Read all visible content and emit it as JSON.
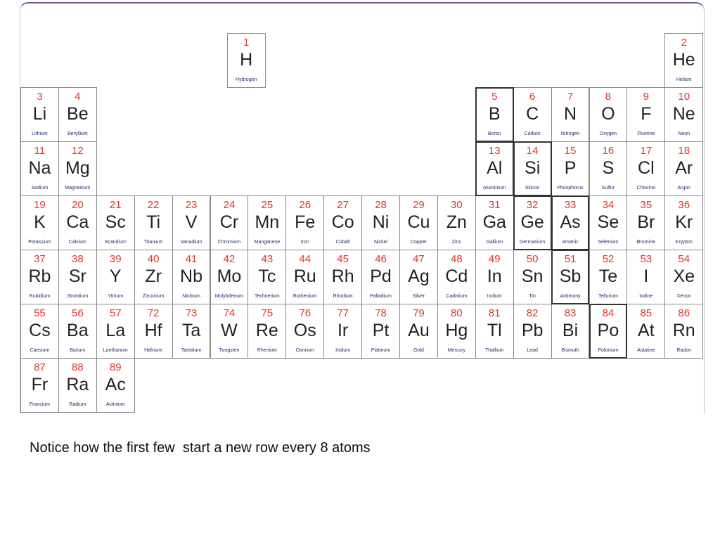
{
  "slide": {
    "caption": "Notice how the first few  start a new row every 8 atoms"
  },
  "colors": {
    "number": "#e3352a",
    "symbol": "#222222",
    "name": "#1d2d6b",
    "grid": "#8a8a8a",
    "heavy": "#333333",
    "frame_top": "#7b5a98",
    "frame_side": "#c4c4c4",
    "caption": "#111111"
  },
  "periodic_table": {
    "rows": [
      [
        {
          "number": 1,
          "symbol": "H",
          "name": "Hydrogen"
        },
        {
          "number": 2,
          "symbol": "He",
          "name": "Helium"
        }
      ],
      [
        {
          "number": 3,
          "symbol": "Li",
          "name": "Lithium"
        },
        {
          "number": 4,
          "symbol": "Be",
          "name": "Beryllium"
        },
        {
          "number": 5,
          "symbol": "B",
          "name": "Boron"
        },
        {
          "number": 6,
          "symbol": "C",
          "name": "Carbon"
        },
        {
          "number": 7,
          "symbol": "N",
          "name": "Nitrogen"
        },
        {
          "number": 8,
          "symbol": "O",
          "name": "Oxygen"
        },
        {
          "number": 9,
          "symbol": "F",
          "name": "Fluorine"
        },
        {
          "number": 10,
          "symbol": "Ne",
          "name": "Neon"
        }
      ],
      [
        {
          "number": 11,
          "symbol": "Na",
          "name": "Sodium"
        },
        {
          "number": 12,
          "symbol": "Mg",
          "name": "Magnesium"
        },
        {
          "number": 13,
          "symbol": "Al",
          "name": "Aluminium"
        },
        {
          "number": 14,
          "symbol": "Si",
          "name": "Silicon"
        },
        {
          "number": 15,
          "symbol": "P",
          "name": "Phosphorus"
        },
        {
          "number": 16,
          "symbol": "S",
          "name": "Sulfur"
        },
        {
          "number": 17,
          "symbol": "Cl",
          "name": "Chlorine"
        },
        {
          "number": 18,
          "symbol": "Ar",
          "name": "Argon"
        }
      ],
      [
        {
          "number": 19,
          "symbol": "K",
          "name": "Potassium"
        },
        {
          "number": 20,
          "symbol": "Ca",
          "name": "Calcium"
        },
        {
          "number": 21,
          "symbol": "Sc",
          "name": "Scandium"
        },
        {
          "number": 22,
          "symbol": "Ti",
          "name": "Titanium"
        },
        {
          "number": 23,
          "symbol": "V",
          "name": "Vanadium"
        },
        {
          "number": 24,
          "symbol": "Cr",
          "name": "Chromium"
        },
        {
          "number": 25,
          "symbol": "Mn",
          "name": "Manganese"
        },
        {
          "number": 26,
          "symbol": "Fe",
          "name": "Iron"
        },
        {
          "number": 27,
          "symbol": "Co",
          "name": "Cobalt"
        },
        {
          "number": 28,
          "symbol": "Ni",
          "name": "Nickel"
        },
        {
          "number": 29,
          "symbol": "Cu",
          "name": "Copper"
        },
        {
          "number": 30,
          "symbol": "Zn",
          "name": "Zinc"
        },
        {
          "number": 31,
          "symbol": "Ga",
          "name": "Gallium"
        },
        {
          "number": 32,
          "symbol": "Ge",
          "name": "Germanium"
        },
        {
          "number": 33,
          "symbol": "As",
          "name": "Arsenic"
        },
        {
          "number": 34,
          "symbol": "Se",
          "name": "Selenium"
        },
        {
          "number": 35,
          "symbol": "Br",
          "name": "Bromine"
        },
        {
          "number": 36,
          "symbol": "Kr",
          "name": "Krypton"
        }
      ],
      [
        {
          "number": 37,
          "symbol": "Rb",
          "name": "Rubidium"
        },
        {
          "number": 38,
          "symbol": "Sr",
          "name": "Strontium"
        },
        {
          "number": 39,
          "symbol": "Y",
          "name": "Yttrium"
        },
        {
          "number": 40,
          "symbol": "Zr",
          "name": "Zirconium"
        },
        {
          "number": 41,
          "symbol": "Nb",
          "name": "Niobium"
        },
        {
          "number": 42,
          "symbol": "Mo",
          "name": "Molybdenum"
        },
        {
          "number": 43,
          "symbol": "Tc",
          "name": "Technetium"
        },
        {
          "number": 44,
          "symbol": "Ru",
          "name": "Ruthenium"
        },
        {
          "number": 45,
          "symbol": "Rh",
          "name": "Rhodium"
        },
        {
          "number": 46,
          "symbol": "Pd",
          "name": "Palladium"
        },
        {
          "number": 47,
          "symbol": "Ag",
          "name": "Silver"
        },
        {
          "number": 48,
          "symbol": "Cd",
          "name": "Cadmium"
        },
        {
          "number": 49,
          "symbol": "In",
          "name": "Indium"
        },
        {
          "number": 50,
          "symbol": "Sn",
          "name": "Tin"
        },
        {
          "number": 51,
          "symbol": "Sb",
          "name": "Antimony"
        },
        {
          "number": 52,
          "symbol": "Te",
          "name": "Tellurium"
        },
        {
          "number": 53,
          "symbol": "I",
          "name": "Iodine"
        },
        {
          "number": 54,
          "symbol": "Xe",
          "name": "Xenon"
        }
      ],
      [
        {
          "number": 55,
          "symbol": "Cs",
          "name": "Caesium"
        },
        {
          "number": 56,
          "symbol": "Ba",
          "name": "Barium"
        },
        {
          "number": 57,
          "symbol": "La",
          "name": "Lanthanum"
        },
        {
          "number": 72,
          "symbol": "Hf",
          "name": "Hafnium"
        },
        {
          "number": 73,
          "symbol": "Ta",
          "name": "Tantalum"
        },
        {
          "number": 74,
          "symbol": "W",
          "name": "Tungsten"
        },
        {
          "number": 75,
          "symbol": "Re",
          "name": "Rhenium"
        },
        {
          "number": 76,
          "symbol": "Os",
          "name": "Osmium"
        },
        {
          "number": 77,
          "symbol": "Ir",
          "name": "Iridium"
        },
        {
          "number": 78,
          "symbol": "Pt",
          "name": "Platinum"
        },
        {
          "number": 79,
          "symbol": "Au",
          "name": "Gold"
        },
        {
          "number": 80,
          "symbol": "Hg",
          "name": "Mercury"
        },
        {
          "number": 81,
          "symbol": "Tl",
          "name": "Thallium"
        },
        {
          "number": 82,
          "symbol": "Pb",
          "name": "Lead"
        },
        {
          "number": 83,
          "symbol": "Bi",
          "name": "Bismuth"
        },
        {
          "number": 84,
          "symbol": "Po",
          "name": "Polonium"
        },
        {
          "number": 85,
          "symbol": "At",
          "name": "Astatine"
        },
        {
          "number": 86,
          "symbol": "Rn",
          "name": "Radon"
        }
      ],
      [
        {
          "number": 87,
          "symbol": "Fr",
          "name": "Francium"
        },
        {
          "number": 88,
          "symbol": "Ra",
          "name": "Radium"
        },
        {
          "number": 89,
          "symbol": "Ac",
          "name": "Actinium"
        }
      ]
    ]
  }
}
